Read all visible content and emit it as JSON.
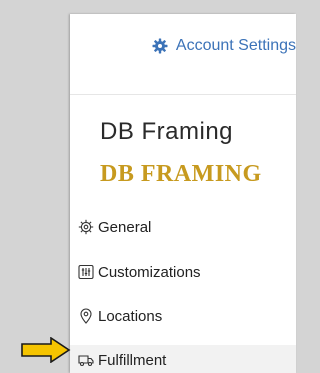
{
  "header": {
    "account_settings_label": "Account Settings",
    "icon": "gear-icon"
  },
  "business": {
    "name": "DB Framing",
    "logo_text": "DB FRAMING"
  },
  "nav": {
    "items": [
      {
        "label": "General",
        "icon": "settings-cog-icon"
      },
      {
        "label": "Customizations",
        "icon": "sliders-icon"
      },
      {
        "label": "Locations",
        "icon": "map-pin-icon"
      },
      {
        "label": "Fulfillment",
        "icon": "truck-icon",
        "active": true
      }
    ]
  },
  "colors": {
    "link": "#3c73b8",
    "logo": "#c79a1f",
    "arrow_fill": "#f5c400"
  }
}
